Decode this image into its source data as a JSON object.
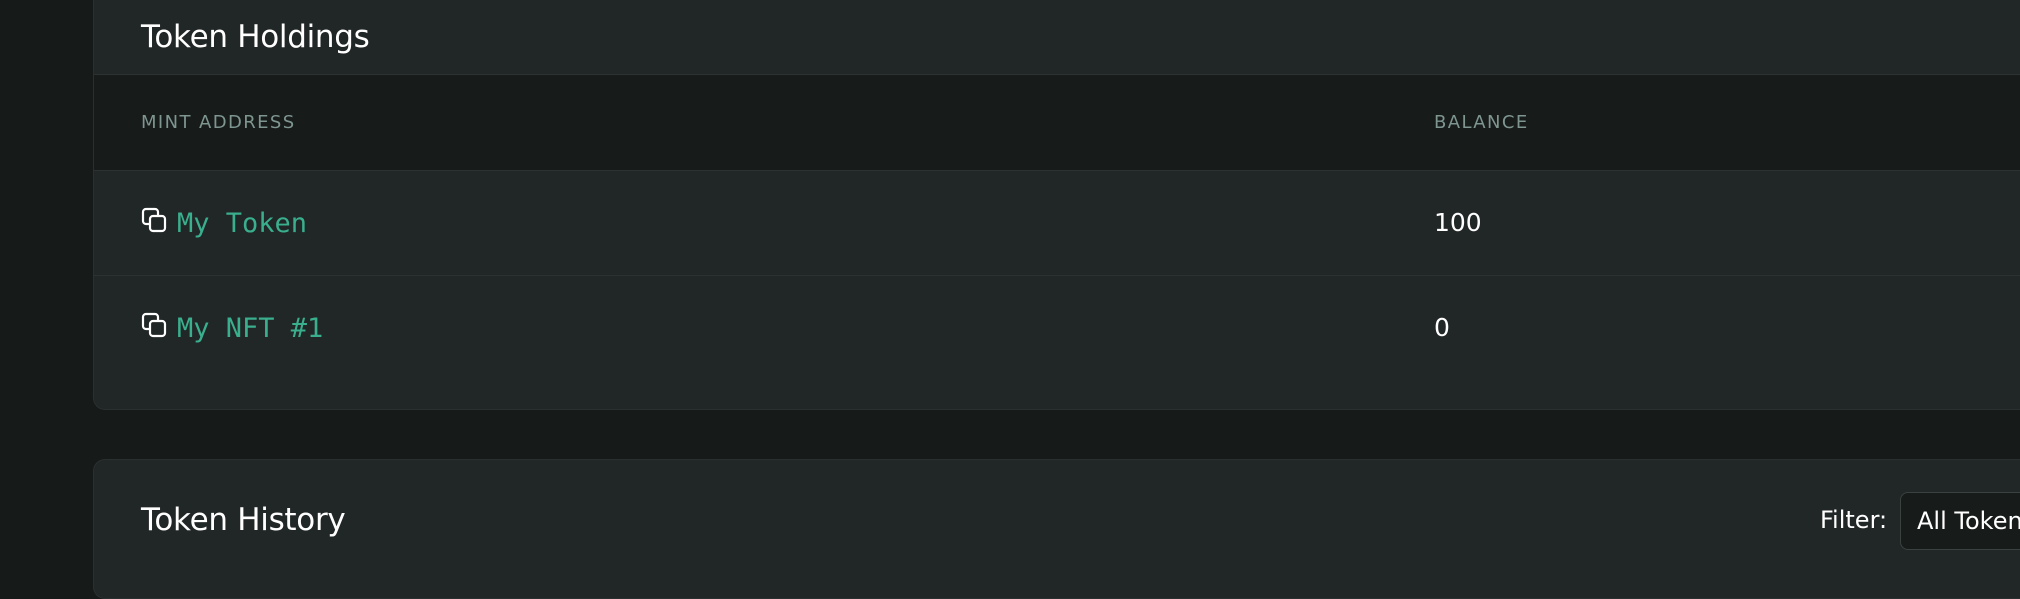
{
  "holdings": {
    "title": "Token Holdings",
    "columns": [
      "MINT ADDRESS",
      "BALANCE"
    ],
    "rows": [
      {
        "mint": "My Token",
        "balance": "100",
        "icon": "copy-icon"
      },
      {
        "mint": "My NFT #1",
        "balance": "0",
        "icon": "copy-icon"
      }
    ]
  },
  "history": {
    "title": "Token History",
    "filter_label": "Filter:",
    "filter_value": "All Tokens"
  },
  "colors": {
    "background": "#161a19",
    "card": "#212626",
    "table_header": "#171b1a",
    "accent": "#3aaf8e",
    "muted_text": "#7e9590"
  }
}
